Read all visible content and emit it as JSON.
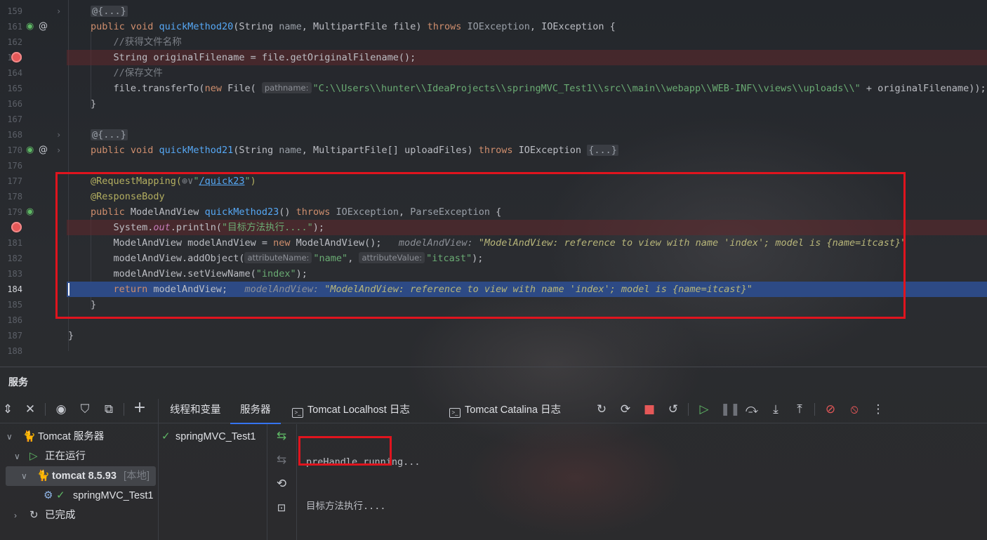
{
  "editor": {
    "lines": [
      {
        "num": "159",
        "fold": "›",
        "code": [
          {
            "c": "fold-ph",
            "t": "@{...}"
          }
        ]
      },
      {
        "num": "161",
        "icons": [
          "run-icon",
          "override-icon"
        ],
        "code": [
          {
            "c": "kw",
            "t": "public void "
          },
          {
            "c": "fn",
            "t": "quickMethod20"
          },
          {
            "c": "ty",
            "t": "(String "
          },
          {
            "c": "par",
            "t": "name"
          },
          {
            "c": "ty",
            "t": ", MultipartFile file) "
          },
          {
            "c": "kw",
            "t": "throws "
          },
          {
            "c": "par",
            "t": "IOException"
          },
          {
            "c": "ty",
            "t": ", IOException {"
          }
        ]
      },
      {
        "num": "162",
        "code": [
          {
            "c": "cmt",
            "t": "    //获得文件名称"
          }
        ]
      },
      {
        "num": "163",
        "bp": true,
        "code": [
          {
            "c": "ty",
            "t": "    String originalFilename = file.getOriginalFilename();"
          }
        ]
      },
      {
        "num": "164",
        "code": [
          {
            "c": "cmt",
            "t": "    //保存文件"
          }
        ]
      },
      {
        "num": "165",
        "code": [
          {
            "c": "ty",
            "t": "    file.transferTo("
          },
          {
            "c": "kw",
            "t": "new "
          },
          {
            "c": "ty",
            "t": "File( "
          },
          {
            "c": "hint",
            "t": "pathname:"
          },
          {
            "c": "str",
            "t": "\"C:\\\\Users\\\\hunter\\\\IdeaProjects\\\\springMVC_Test1\\\\src\\\\main\\\\webapp\\\\WEB-INF\\\\views\\\\uploads\\\\\""
          },
          {
            "c": "ty",
            "t": " + originalFilename));"
          }
        ]
      },
      {
        "num": "166",
        "code": [
          {
            "c": "ty",
            "t": "}"
          }
        ]
      },
      {
        "num": "167",
        "code": []
      },
      {
        "num": "168",
        "fold": "›",
        "code": [
          {
            "c": "fold-ph",
            "t": "@{...}"
          }
        ]
      },
      {
        "num": "170",
        "icons": [
          "run-icon",
          "override-icon"
        ],
        "fold": "›",
        "code": [
          {
            "c": "kw",
            "t": "public void "
          },
          {
            "c": "fn",
            "t": "quickMethod21"
          },
          {
            "c": "ty",
            "t": "(String "
          },
          {
            "c": "par",
            "t": "name"
          },
          {
            "c": "ty",
            "t": ", MultipartFile[] uploadFiles) "
          },
          {
            "c": "kw",
            "t": "throws "
          },
          {
            "c": "ty",
            "t": "IOException "
          },
          {
            "c": "fold-ph",
            "t": "{...}"
          }
        ]
      },
      {
        "num": "176",
        "code": []
      },
      {
        "num": "177",
        "code": [
          {
            "c": "ann",
            "t": "@RequestMapping("
          },
          {
            "c": "cmt",
            "t": "⊕∨"
          },
          {
            "c": "str",
            "t": "\""
          },
          {
            "c": "link",
            "t": "/quick23"
          },
          {
            "c": "str",
            "t": "\""
          },
          {
            "c": "ann",
            "t": ")"
          }
        ]
      },
      {
        "num": "178",
        "code": [
          {
            "c": "ann",
            "t": "@ResponseBody"
          }
        ]
      },
      {
        "num": "179",
        "icons": [
          "run-icon"
        ],
        "code": [
          {
            "c": "kw",
            "t": "public "
          },
          {
            "c": "ty",
            "t": "ModelAndView "
          },
          {
            "c": "fn",
            "t": "quickMethod23"
          },
          {
            "c": "ty",
            "t": "() "
          },
          {
            "c": "kw",
            "t": "throws "
          },
          {
            "c": "par",
            "t": "IOException"
          },
          {
            "c": "ty",
            "t": ", "
          },
          {
            "c": "par",
            "t": "ParseException"
          },
          {
            "c": "ty",
            "t": " {"
          }
        ]
      },
      {
        "num": "180",
        "bp": true,
        "hideNum": true,
        "code": [
          {
            "c": "ty",
            "t": "    System."
          },
          {
            "c": "field",
            "t": "out"
          },
          {
            "c": "ty",
            "t": ".println("
          },
          {
            "c": "str",
            "t": "\"目标方法执行....\""
          },
          {
            "c": "ty",
            "t": ");"
          }
        ]
      },
      {
        "num": "181",
        "code": [
          {
            "c": "ty",
            "t": "    ModelAndView modelAndView = "
          },
          {
            "c": "kw",
            "t": "new "
          },
          {
            "c": "ty",
            "t": "ModelAndView();   "
          },
          {
            "c": "dbg",
            "t": "modelAndView: ",
            "v": "\"ModelAndView: reference to view with name 'index'; model is {name=itcast}\""
          }
        ]
      },
      {
        "num": "182",
        "code": [
          {
            "c": "ty",
            "t": "    modelAndView.addObject("
          },
          {
            "c": "hint",
            "t": "attributeName:"
          },
          {
            "c": "str",
            "t": "\"name\""
          },
          {
            "c": "ty",
            "t": ", "
          },
          {
            "c": "hint",
            "t": "attributeValue:"
          },
          {
            "c": "str",
            "t": "\"itcast\""
          },
          {
            "c": "ty",
            "t": ");"
          }
        ]
      },
      {
        "num": "183",
        "code": [
          {
            "c": "ty",
            "t": "    modelAndView.setViewName("
          },
          {
            "c": "str",
            "t": "\"index\""
          },
          {
            "c": "ty",
            "t": ");"
          }
        ]
      },
      {
        "num": "184",
        "current": true,
        "code": [
          {
            "c": "kw",
            "t": "    return "
          },
          {
            "c": "ty",
            "t": "modelAndView;   "
          },
          {
            "c": "dbg",
            "t": "modelAndView: ",
            "v": "\"ModelAndView: reference to view with name 'index'; model is {name=itcast}\""
          }
        ]
      },
      {
        "num": "185",
        "code": [
          {
            "c": "ty",
            "t": "}"
          }
        ]
      },
      {
        "num": "186",
        "code": []
      },
      {
        "num": "187",
        "code": [
          {
            "c": "ty",
            "t": "}"
          }
        ]
      },
      {
        "num": "188",
        "code": []
      }
    ]
  },
  "services": {
    "title": "服务",
    "tabs": [
      "线程和变量",
      "服务器",
      "Tomcat Localhost 日志",
      "Tomcat Catalina 日志"
    ],
    "active_tab": "服务器",
    "tree": {
      "server": "Tomcat 服务器",
      "running": "正在运行",
      "tomcat_name": "tomcat 8.5.93",
      "tomcat_tag": "[本地]",
      "artifact": "springMVC_Test1",
      "finished": "已完成"
    },
    "deployment": "springMVC_Test1",
    "console_lines": [
      "preHandle running...",
      "目标方法执行...."
    ]
  },
  "colors": {
    "accent": "#3574f0",
    "highlight_box": "#e0141e",
    "current_line": "#2d4a85",
    "breakpoint": "#e55858"
  }
}
